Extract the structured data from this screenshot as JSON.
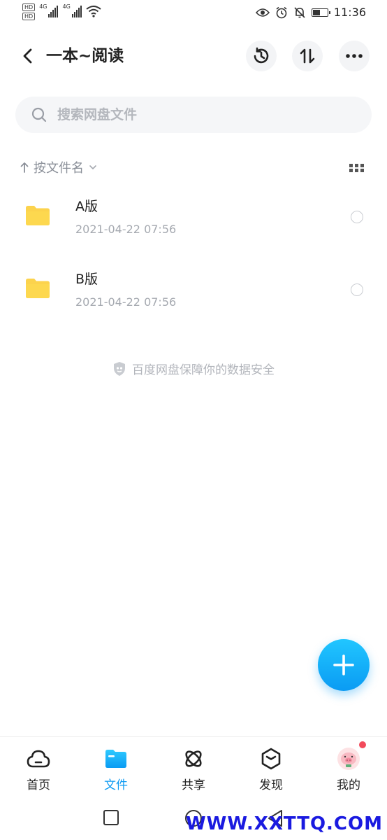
{
  "status_bar": {
    "hd1": "HD",
    "hd2": "HD",
    "net1": "4G",
    "net2": "4G",
    "time": "11:36",
    "battery_level": 0.55
  },
  "header": {
    "title": "一本~阅读"
  },
  "search": {
    "placeholder": "搜索网盘文件"
  },
  "sort": {
    "label": "按文件名"
  },
  "files": [
    {
      "name": "A版",
      "date": "2021-04-22  07:56"
    },
    {
      "name": "B版",
      "date": "2021-04-22  07:56"
    }
  ],
  "security_note": "百度网盘保障你的数据安全",
  "tabs": [
    {
      "label": "首页",
      "icon": "cloud-icon",
      "active": false
    },
    {
      "label": "文件",
      "icon": "folder-icon",
      "active": true
    },
    {
      "label": "共享",
      "icon": "orbit-icon",
      "active": false
    },
    {
      "label": "发现",
      "icon": "cube-icon",
      "active": false
    },
    {
      "label": "我的",
      "icon": "avatar-icon",
      "active": false
    }
  ],
  "watermark": "WWW.XXTTQ.COM",
  "colors": {
    "accent": "#0f9bf2",
    "folder": "#fcd34d",
    "badge": "#f24a5b"
  }
}
